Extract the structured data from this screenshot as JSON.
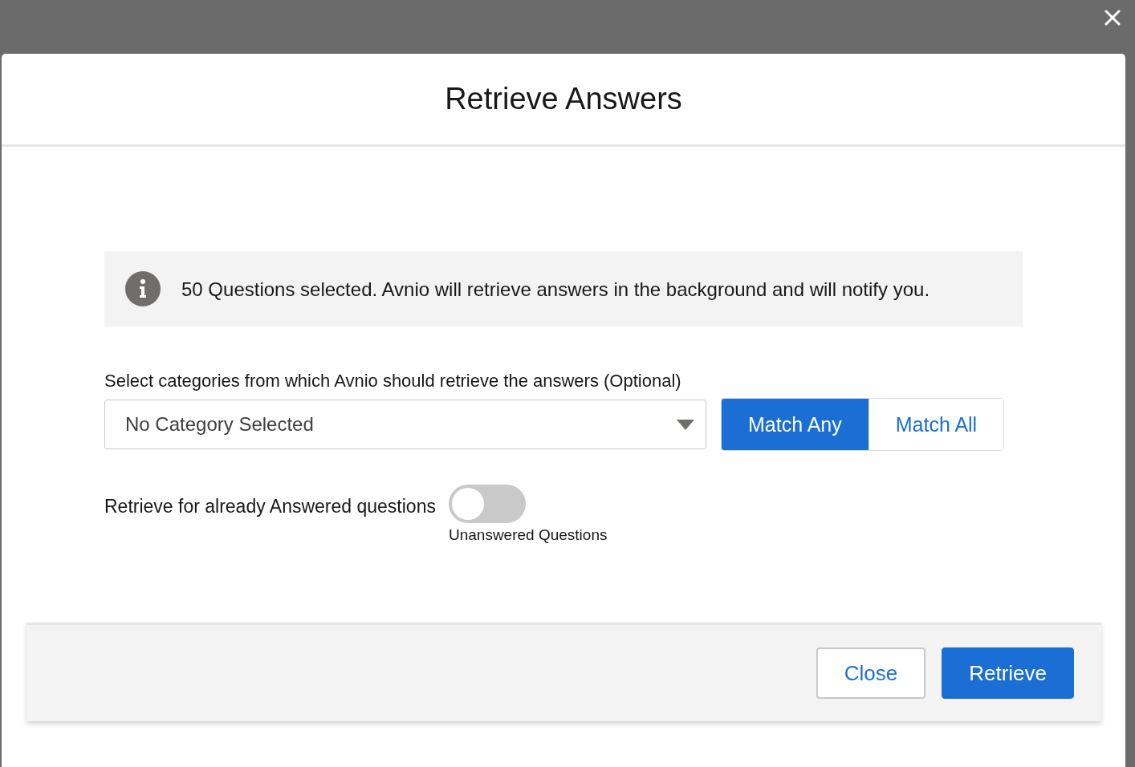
{
  "modal": {
    "title": "Retrieve Answers"
  },
  "info": {
    "text": "50 Questions selected. Avnio will retrieve answers in the background and will notify you."
  },
  "categories": {
    "label": "Select categories from which Avnio should retrieve the answers (Optional)",
    "placeholder": "No Category Selected"
  },
  "match_options": [
    {
      "label": "Match Any",
      "selected": true
    },
    {
      "label": "Match All",
      "selected": false
    }
  ],
  "answered_toggle": {
    "label": "Retrieve for already Answered questions",
    "on": false,
    "caption": "Unanswered Questions"
  },
  "buttons": [
    {
      "label": "Close",
      "kind": "neutral"
    },
    {
      "label": "Retrieve",
      "kind": "brand"
    }
  ]
}
